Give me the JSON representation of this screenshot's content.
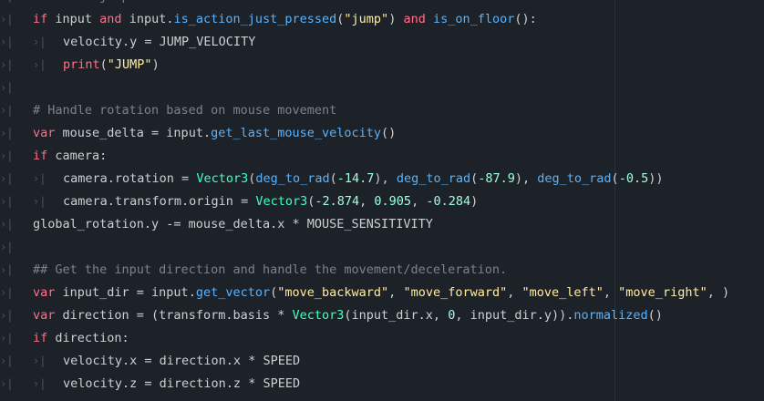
{
  "editor": {
    "tab_glyph": "›|",
    "lines": [
      {
        "tabs": 1,
        "tokens": [
          {
            "t": "# Handle jump.",
            "c": "cm"
          }
        ]
      },
      {
        "tabs": 1,
        "tokens": [
          {
            "t": "if",
            "c": "kw"
          },
          {
            "t": " input ",
            "c": "txt"
          },
          {
            "t": "and",
            "c": "kw"
          },
          {
            "t": " input.",
            "c": "txt"
          },
          {
            "t": "is_action_just_pressed",
            "c": "fn"
          },
          {
            "t": "(",
            "c": "txt"
          },
          {
            "t": "\"jump\"",
            "c": "str"
          },
          {
            "t": ") ",
            "c": "txt"
          },
          {
            "t": "and",
            "c": "kw"
          },
          {
            "t": " ",
            "c": "txt"
          },
          {
            "t": "is_on_floor",
            "c": "fn"
          },
          {
            "t": "():",
            "c": "txt"
          }
        ]
      },
      {
        "tabs": 2,
        "tokens": [
          {
            "t": "velocity.y = JUMP_VELOCITY",
            "c": "txt"
          }
        ]
      },
      {
        "tabs": 2,
        "tokens": [
          {
            "t": "print",
            "c": "kw"
          },
          {
            "t": "(",
            "c": "txt"
          },
          {
            "t": "\"JUMP\"",
            "c": "str"
          },
          {
            "t": ")",
            "c": "txt"
          }
        ]
      },
      {
        "tabs": 1,
        "tokens": []
      },
      {
        "tabs": 1,
        "tokens": [
          {
            "t": "# Handle rotation based on mouse movement",
            "c": "cm"
          }
        ]
      },
      {
        "tabs": 1,
        "tokens": [
          {
            "t": "var",
            "c": "kw"
          },
          {
            "t": " mouse_delta = input.",
            "c": "txt"
          },
          {
            "t": "get_last_mouse_velocity",
            "c": "fn"
          },
          {
            "t": "()",
            "c": "txt"
          }
        ]
      },
      {
        "tabs": 1,
        "tokens": [
          {
            "t": "if",
            "c": "kw"
          },
          {
            "t": " camera:",
            "c": "txt"
          }
        ]
      },
      {
        "tabs": 2,
        "tokens": [
          {
            "t": "camera.rotation = ",
            "c": "txt"
          },
          {
            "t": "Vector3",
            "c": "ty"
          },
          {
            "t": "(",
            "c": "txt"
          },
          {
            "t": "deg_to_rad",
            "c": "fn"
          },
          {
            "t": "(",
            "c": "txt"
          },
          {
            "t": "-14.7",
            "c": "num"
          },
          {
            "t": "), ",
            "c": "txt"
          },
          {
            "t": "deg_to_rad",
            "c": "fn"
          },
          {
            "t": "(",
            "c": "txt"
          },
          {
            "t": "-87.9",
            "c": "num"
          },
          {
            "t": "), ",
            "c": "txt"
          },
          {
            "t": "deg_to_rad",
            "c": "fn"
          },
          {
            "t": "(",
            "c": "txt"
          },
          {
            "t": "-0.5",
            "c": "num"
          },
          {
            "t": "))",
            "c": "txt"
          }
        ]
      },
      {
        "tabs": 2,
        "tokens": [
          {
            "t": "camera.transform.origin = ",
            "c": "txt"
          },
          {
            "t": "Vector3",
            "c": "ty"
          },
          {
            "t": "(",
            "c": "txt"
          },
          {
            "t": "-2.874",
            "c": "num"
          },
          {
            "t": ", ",
            "c": "txt"
          },
          {
            "t": "0.905",
            "c": "num"
          },
          {
            "t": ", ",
            "c": "txt"
          },
          {
            "t": "-0.284",
            "c": "num"
          },
          {
            "t": ")",
            "c": "txt"
          }
        ]
      },
      {
        "tabs": 1,
        "tokens": [
          {
            "t": "global_rotation.y -= mouse_delta.x * MOUSE_SENSITIVITY",
            "c": "txt"
          }
        ]
      },
      {
        "tabs": 1,
        "tokens": []
      },
      {
        "tabs": 1,
        "tokens": [
          {
            "t": "## Get the input direction and handle the movement/deceleration.",
            "c": "cm"
          }
        ]
      },
      {
        "tabs": 1,
        "tokens": [
          {
            "t": "var",
            "c": "kw"
          },
          {
            "t": " input_dir = input.",
            "c": "txt"
          },
          {
            "t": "get_vector",
            "c": "fn"
          },
          {
            "t": "(",
            "c": "txt"
          },
          {
            "t": "\"move_backward\"",
            "c": "str"
          },
          {
            "t": ", ",
            "c": "txt"
          },
          {
            "t": "\"move_forward\"",
            "c": "str"
          },
          {
            "t": ", ",
            "c": "txt"
          },
          {
            "t": "\"move_left\"",
            "c": "str"
          },
          {
            "t": ", ",
            "c": "txt"
          },
          {
            "t": "\"move_right\"",
            "c": "str"
          },
          {
            "t": ", )",
            "c": "txt"
          }
        ]
      },
      {
        "tabs": 1,
        "tokens": [
          {
            "t": "var",
            "c": "kw"
          },
          {
            "t": " direction = (transform.basis * ",
            "c": "txt"
          },
          {
            "t": "Vector3",
            "c": "ty"
          },
          {
            "t": "(input_dir.x, ",
            "c": "txt"
          },
          {
            "t": "0",
            "c": "num"
          },
          {
            "t": ", input_dir.y)).",
            "c": "txt"
          },
          {
            "t": "normalized",
            "c": "fn"
          },
          {
            "t": "()",
            "c": "txt"
          }
        ]
      },
      {
        "tabs": 1,
        "tokens": [
          {
            "t": "if",
            "c": "kw"
          },
          {
            "t": " direction:",
            "c": "txt"
          }
        ]
      },
      {
        "tabs": 2,
        "tokens": [
          {
            "t": "velocity.x = direction.x * SPEED",
            "c": "txt"
          }
        ]
      },
      {
        "tabs": 2,
        "tokens": [
          {
            "t": "velocity.z = direction.z * SPEED",
            "c": "txt"
          }
        ]
      }
    ]
  }
}
